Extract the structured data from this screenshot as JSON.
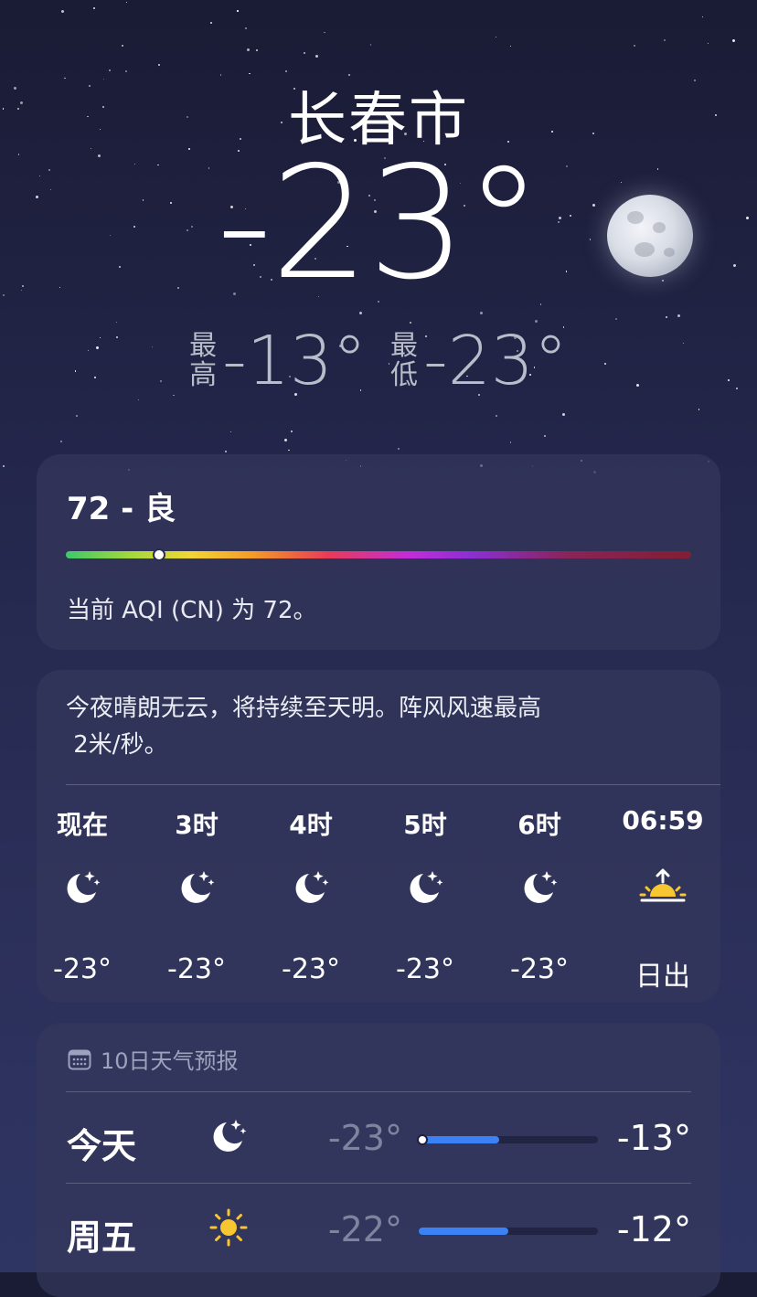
{
  "location": {
    "city": "长春市",
    "temperature": "-23°"
  },
  "hilo": {
    "high_label_1": "最",
    "high_label_2": "高",
    "high_value": "-13°",
    "low_label_1": "最",
    "low_label_2": "低",
    "low_value": "-23°"
  },
  "aqi": {
    "title": "72 - 良",
    "description": "当前 AQI (CN) 为 72。",
    "value": 72,
    "scale_position": 0.148
  },
  "hourly": {
    "summary_line1": "今夜晴朗无云，将持续至天明。阵风风速最高",
    "summary_line2": " 2米/秒。",
    "items": [
      {
        "time": "现在",
        "icon": "moon-stars-icon",
        "value": "-23°"
      },
      {
        "time": "3时",
        "icon": "moon-stars-icon",
        "value": "-23°"
      },
      {
        "time": "4时",
        "icon": "moon-stars-icon",
        "value": "-23°"
      },
      {
        "time": "5时",
        "icon": "moon-stars-icon",
        "value": "-23°"
      },
      {
        "time": "6时",
        "icon": "moon-stars-icon",
        "value": "-23°"
      },
      {
        "time": "06:59",
        "icon": "sunrise-icon",
        "value": "日出"
      }
    ]
  },
  "daily": {
    "title": "10日天气预报",
    "rows": [
      {
        "day": "今天",
        "icon": "moon-stars-icon",
        "low": "-23°",
        "high": "-13°",
        "range_start": 0.0,
        "range_end": 0.45,
        "current_marker": 0.0
      },
      {
        "day": "周五",
        "icon": "sun-icon",
        "low": "-22°",
        "high": "-12°",
        "range_start": 0.0,
        "range_end": 0.5
      }
    ]
  },
  "colors": {
    "sun": "#f7c631",
    "bar_fill": "#3b82f6"
  }
}
